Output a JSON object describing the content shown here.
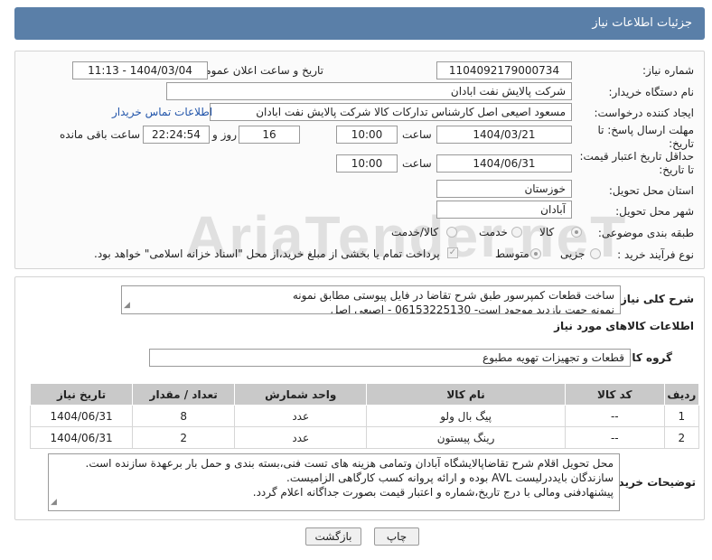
{
  "header": {
    "title": "جزئیات اطلاعات نیاز"
  },
  "form": {
    "need_number_label": "شماره نیاز:",
    "need_number": "1104092179000734",
    "announce_label": "تاریخ و ساعت اعلان عمومی:",
    "announce_value": "1404/03/04 - 11:13",
    "buyer_org_label": "نام دستگاه خریدار:",
    "buyer_org": "شرکت پالایش نفت ابادان",
    "creator_label": "ایجاد کننده درخواست:",
    "creator": "مسعود اصیعی اصل کارشناس تدارکات کالا  شرکت پالایش نفت ابادان",
    "contact_link": "اطلاعات تماس خریدار",
    "reply_deadline_label": "مهلت ارسال پاسخ: تا تاریخ:",
    "reply_date": "1404/03/21",
    "time_label": "ساعت",
    "reply_time": "10:00",
    "days_value": "16",
    "days_label": "روز و",
    "remaining_time": "22:24:54",
    "remaining_label": "ساعت باقی مانده",
    "validity_label": "حداقل تاریخ اعتبار قیمت: تا تاریخ:",
    "validity_date": "1404/06/31",
    "validity_time": "10:00",
    "province_label": "استان محل تحویل:",
    "province": "خوزستان",
    "city_label": "شهر محل تحویل:",
    "city": "آبادان",
    "category_label": "طبقه بندی موضوعی:",
    "category_options": [
      "کالا",
      "خدمت",
      "کالا/خدمت"
    ],
    "process_label": "نوع فرآیند خرید :",
    "process_options": [
      "جزیی",
      "متوسط"
    ],
    "payment_note": "پرداخت تمام یا بخشی از مبلغ خرید،از محل \"اسناد خزانه اسلامی\" خواهد بود."
  },
  "description": {
    "label": "شرح کلی نیاز:",
    "line1": "ساخت قطعات کمپرسور طبق شرح تقاضا در فایل پیوستی مطابق نمونه",
    "line2": "نمونه جهت بازدید موجود است- 06153225130 - اصیعی اصل"
  },
  "goods": {
    "section_title": "اطلاعات کالاهای مورد نیاز",
    "group_label": "گروه کالا:",
    "group_value": "قطعات و تجهیزات تهویه مطبوع"
  },
  "table": {
    "headers": [
      "ردیف",
      "کد کالا",
      "نام کالا",
      "واحد شمارش",
      "تعداد / مقدار",
      "تاریخ نیاز"
    ],
    "rows": [
      [
        "1",
        "--",
        "پیگ بال ولو",
        "عدد",
        "8",
        "1404/06/31"
      ],
      [
        "2",
        "--",
        "رینگ پیستون",
        "عدد",
        "2",
        "1404/06/31"
      ]
    ]
  },
  "buyer_notes": {
    "label": "توضیحات خریدار:",
    "line1": "محل تحویل اقلام شرح تقاضاپالایشگاه آبادان وتمامی هزینه های تست فنی،بسته بندی و حمل بار برعهدة سازنده است.",
    "line2": "سازندگان بایددرلیست AVL بوده و ارائه پروانه کسب کارگاهی الزامیست.",
    "line3": "پیشنهادفنی ومالی با درج تاریخ،شماره و اعتبار قیمت بصورت جداگانه اعلام گردد."
  },
  "buttons": {
    "print": "چاپ",
    "back": "بازگشت"
  },
  "watermark": "AriaTender.neT"
}
